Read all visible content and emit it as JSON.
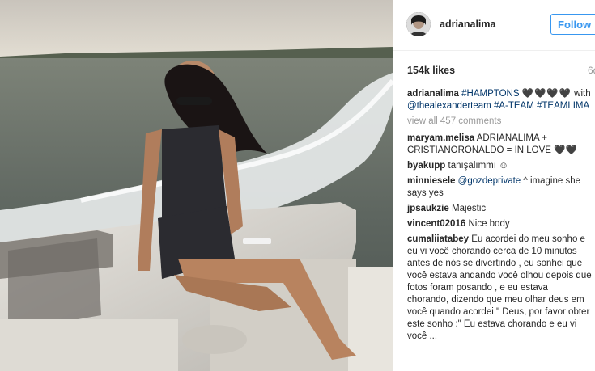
{
  "post": {
    "username": "adrianalima",
    "follow_label": "Follow",
    "likes": "154k likes",
    "time_ago": "6d"
  },
  "caption": {
    "username": "adrianalima",
    "tag1": "#HAMPTONS",
    "hearts": "🖤🖤🖤🖤",
    "with": "with",
    "mention": "@thealexanderteam",
    "tag2": "#A-TEAM",
    "tag3": "#TEAMLIMA"
  },
  "view_all": "view all 457 comments",
  "comments": [
    {
      "user": "maryam.melisa",
      "text": "ADRIANALIMA + CRISTIANORONALDO = IN LOVE 🖤🖤"
    },
    {
      "user": "byakupp",
      "text": "tanışalımmı ☺"
    },
    {
      "user": "minniesele",
      "mention": "@gozdeprivate",
      "text": "^ imagine she says yes"
    },
    {
      "user": "jpsaukzie",
      "text": "Majestic"
    },
    {
      "user": "vincent02016",
      "text": "Nice body"
    },
    {
      "user": "cumaliiatabey",
      "text": "Eu acordei do meu sonho e eu vi você chorando cerca de 10 minutos antes de nós se divertindo , eu sonhei que você estava andando você olhou depois que fotos foram posando , e eu estava chorando, dizendo que meu olhar deus em você quando acordei \" Deus, por favor obter este sonho :\" Eu estava chorando e eu vi você ..."
    }
  ]
}
